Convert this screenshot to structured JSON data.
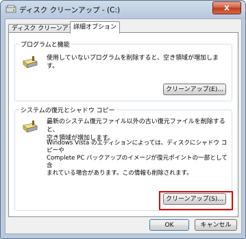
{
  "window": {
    "title": "ディスク クリーンアップ - (C:)",
    "close_label": "x"
  },
  "tabs": [
    {
      "label": "ディスク クリーンアップ",
      "active": false
    },
    {
      "label": "詳細オプション",
      "active": true
    }
  ],
  "programs": {
    "group_title": "プログラムと機能",
    "description": "使用していないプログラムを削除すると、空き領域が増加します。",
    "button_label": "クリーンアップ(E)..."
  },
  "restore": {
    "group_title": "システムの復元とシャドウ コピー",
    "description_1": "最新のシステム復元ファイル以外の古い復元ファイルを削除すると、",
    "description_2": "空き領域が増加します。",
    "note_1": "Windows Vista のエディションによっては、ディスクにシャドウ コピーや",
    "note_2": "Complete PC バックアップのイメージが復元ポイントの一部として含",
    "note_3": "まれている場合があります。この情報も削除されます。",
    "button_label": "クリーンアップ(S)..."
  },
  "footer": {
    "ok_label": "OK",
    "cancel_label": "キャンセル"
  },
  "colors": {
    "highlight": "#e00000",
    "close_button": "#c0391b"
  }
}
